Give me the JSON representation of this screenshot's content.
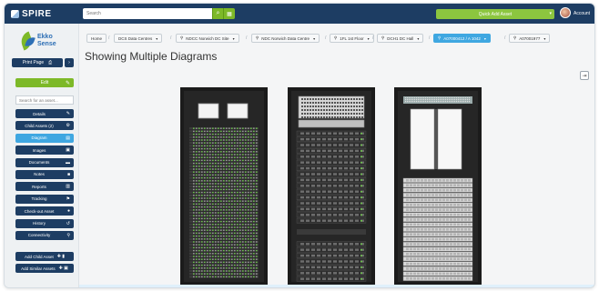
{
  "topbar": {
    "logo_text": "SPIRE",
    "search_placeholder": "Search",
    "quick_add_label": "Quick Add Asset",
    "account_label": "Account"
  },
  "sidebar": {
    "brand_line1": "Ekko",
    "brand_line2": "Sense",
    "print_label": "Print Page",
    "edit_label": "Edit",
    "search_placeholder": "Search for an asset...",
    "nav_items": [
      {
        "label": "Details",
        "icon": "pencil-icon"
      },
      {
        "label": "Child Assets (2)",
        "icon": "gear-icon"
      },
      {
        "label": "Diagram",
        "icon": "diagram-icon",
        "active": true
      },
      {
        "label": "Images",
        "icon": "image-icon"
      },
      {
        "label": "Documents",
        "icon": "document-icon"
      },
      {
        "label": "Notes",
        "icon": "note-icon"
      },
      {
        "label": "Reports",
        "icon": "report-icon"
      },
      {
        "label": "Tracking",
        "icon": "tracking-icon"
      },
      {
        "label": "Check-out Asset",
        "icon": "checkout-icon"
      },
      {
        "label": "History",
        "icon": "history-icon"
      },
      {
        "label": "Connectivity",
        "icon": "connectivity-icon"
      }
    ],
    "add_child_label": "Add Child Asset",
    "add_similar_label": "Add Similar Assets"
  },
  "breadcrumb": [
    {
      "label": "Home",
      "caret": false,
      "pin": false
    },
    {
      "label": "DCS Data Centres",
      "caret": true,
      "pin": false
    },
    {
      "label": "NDCC Norwich DC Site",
      "caret": true,
      "pin": true
    },
    {
      "label": "NDC Norwich Data Centre",
      "caret": true,
      "pin": true
    },
    {
      "label": "1FL 1st Floor",
      "caret": true,
      "pin": true
    },
    {
      "label": "DCH1 DC Hall",
      "caret": true,
      "pin": true
    },
    {
      "label": "A07000412 / A 1042",
      "caret": true,
      "pin": true,
      "active": true
    },
    {
      "label": "A07001977",
      "caret": true,
      "pin": true
    }
  ],
  "main": {
    "title": "Showing Multiple Diagrams"
  },
  "colors": {
    "navy": "#1d3d63",
    "green": "#7db928",
    "active_blue": "#3fa7e1",
    "rack_body": "#1b1b1b"
  }
}
